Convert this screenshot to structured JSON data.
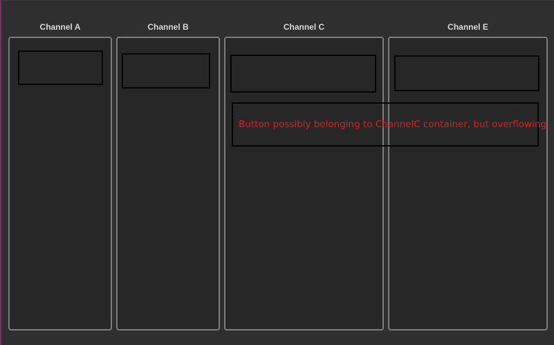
{
  "channels": [
    {
      "id": "a",
      "title": "Channel A"
    },
    {
      "id": "b",
      "title": "Channel B"
    },
    {
      "id": "c",
      "title": "Channel C"
    },
    {
      "id": "e",
      "title": "Channel E"
    }
  ],
  "overflow_button": {
    "label": "Button possibly belonging to ChannelC container, but overflowing"
  },
  "colors": {
    "background": "#2f2f2f",
    "panel": "#272727",
    "panel_border": "#7d7d7d",
    "title_text": "#d8d8d8",
    "warning_text": "#e01e1e"
  }
}
